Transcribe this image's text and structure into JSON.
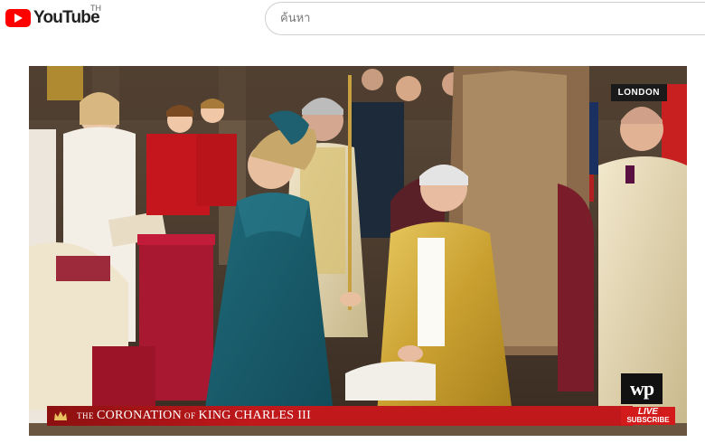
{
  "header": {
    "logo_text": "YouTube",
    "region": "TH",
    "search_placeholder": "ค้นหา",
    "brand_color": "#ff0000"
  },
  "video": {
    "location_badge": "LONDON",
    "lower_third": {
      "the": "THE",
      "title1": "CORONATION",
      "of": "OF",
      "title2": "KING CHARLES III"
    },
    "watermark": "wp",
    "live_badge": {
      "line1": "LIVE",
      "line2": "SUBSCRIBE"
    }
  }
}
